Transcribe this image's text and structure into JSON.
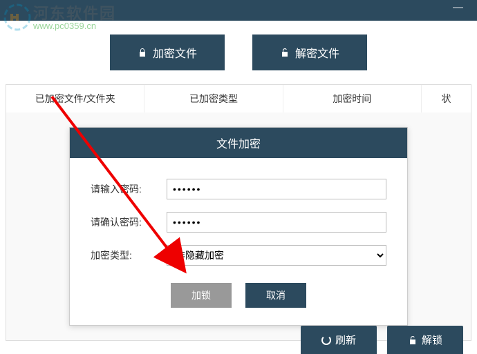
{
  "watermark": {
    "text": "河东软件园",
    "url": "www.pc0359.cn"
  },
  "topButtons": {
    "encrypt": "加密文件",
    "decrypt": "解密文件"
  },
  "tableHeaders": {
    "col1": "已加密文件/文件夹",
    "col2": "已加密类型",
    "col3": "加密时间",
    "col4": "状"
  },
  "dialog": {
    "title": "文件加密",
    "passwordLabel": "请输入密码:",
    "passwordValue": "••••••",
    "confirmLabel": "请确认密码:",
    "confirmValue": "••••••",
    "typeLabel": "加密类型:",
    "typeValue": "非隐藏加密",
    "lockBtn": "加锁",
    "cancelBtn": "取消"
  },
  "bottomButtons": {
    "refresh": "刷新",
    "unlock": "解锁"
  }
}
